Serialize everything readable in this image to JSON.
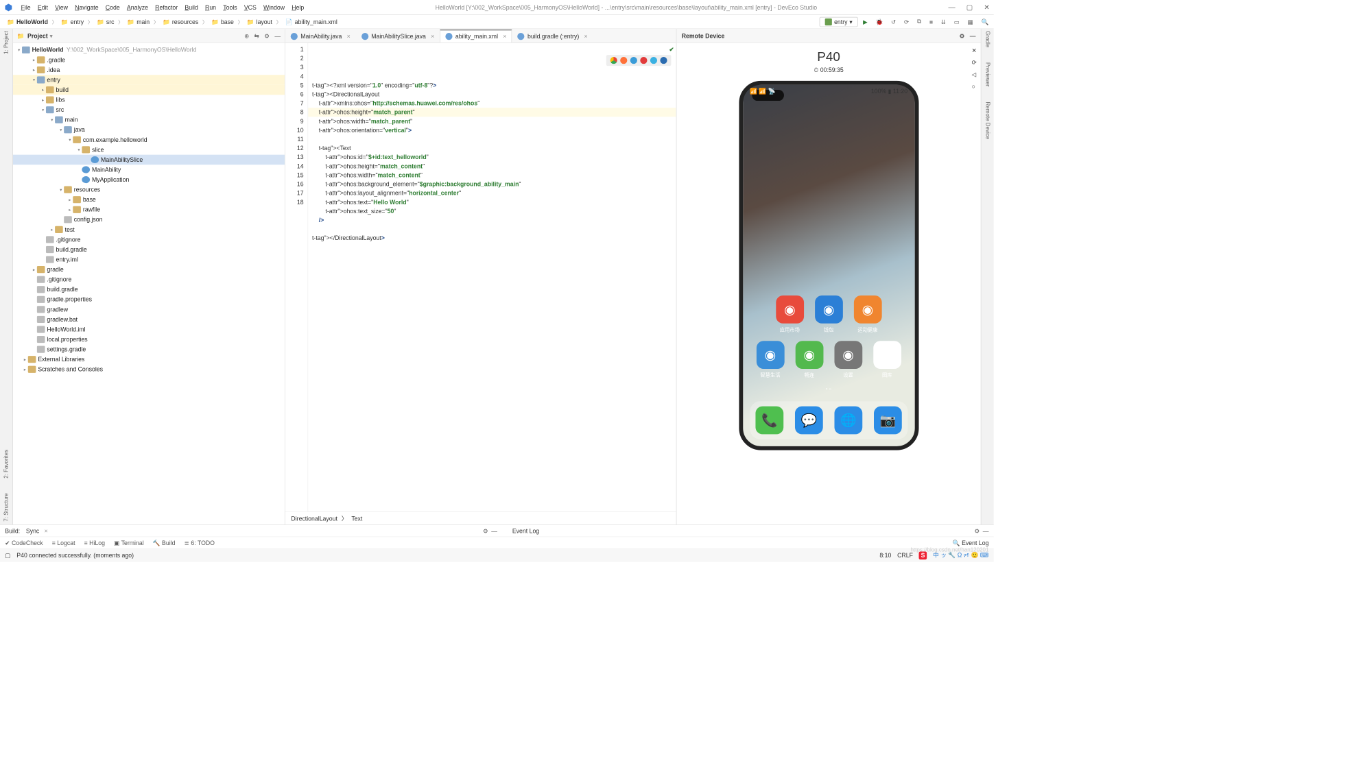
{
  "titlebar": {
    "title": "HelloWorld [Y:\\002_WorkSpace\\005_HarmonyOS\\HelloWorld] - ...\\entry\\src\\main\\resources\\base\\layout\\ability_main.xml [entry] - DevEco Studio"
  },
  "menubar": [
    "File",
    "Edit",
    "View",
    "Navigate",
    "Code",
    "Analyze",
    "Refactor",
    "Build",
    "Run",
    "Tools",
    "VCS",
    "Window",
    "Help"
  ],
  "breadcrumb": [
    "HelloWorld",
    "entry",
    "src",
    "main",
    "resources",
    "base",
    "layout",
    "ability_main.xml"
  ],
  "run_config": "entry",
  "project": {
    "title": "Project",
    "root": {
      "name": "HelloWorld",
      "path": "Y:\\002_WorkSpace\\005_HarmonyOS\\HelloWorld"
    },
    "items": [
      {
        "d": 1,
        "t": "folder",
        "n": ".gradle"
      },
      {
        "d": 1,
        "t": "folder",
        "n": ".idea"
      },
      {
        "d": 1,
        "t": "folder-blue",
        "n": "entry",
        "open": true,
        "hl": true
      },
      {
        "d": 2,
        "t": "folder",
        "n": "build",
        "hl": true
      },
      {
        "d": 2,
        "t": "folder",
        "n": "libs"
      },
      {
        "d": 2,
        "t": "folder-blue",
        "n": "src",
        "open": true
      },
      {
        "d": 3,
        "t": "folder-blue",
        "n": "main",
        "open": true
      },
      {
        "d": 4,
        "t": "folder-blue",
        "n": "java",
        "open": true
      },
      {
        "d": 5,
        "t": "folder",
        "n": "com.example.helloworld",
        "open": true
      },
      {
        "d": 6,
        "t": "folder",
        "n": "slice",
        "open": true
      },
      {
        "d": 7,
        "t": "java",
        "n": "MainAbilitySlice",
        "sel": true
      },
      {
        "d": 6,
        "t": "java",
        "n": "MainAbility"
      },
      {
        "d": 6,
        "t": "java",
        "n": "MyApplication"
      },
      {
        "d": 4,
        "t": "folder",
        "n": "resources",
        "open": true
      },
      {
        "d": 5,
        "t": "folder",
        "n": "base"
      },
      {
        "d": 5,
        "t": "folder",
        "n": "rawfile"
      },
      {
        "d": 4,
        "t": "file",
        "n": "config.json"
      },
      {
        "d": 3,
        "t": "folder",
        "n": "test"
      },
      {
        "d": 2,
        "t": "file",
        "n": ".gitignore"
      },
      {
        "d": 2,
        "t": "file",
        "n": "build.gradle"
      },
      {
        "d": 2,
        "t": "file",
        "n": "entry.iml"
      },
      {
        "d": 1,
        "t": "folder",
        "n": "gradle"
      },
      {
        "d": 1,
        "t": "file",
        "n": ".gitignore"
      },
      {
        "d": 1,
        "t": "file",
        "n": "build.gradle"
      },
      {
        "d": 1,
        "t": "file",
        "n": "gradle.properties"
      },
      {
        "d": 1,
        "t": "file",
        "n": "gradlew"
      },
      {
        "d": 1,
        "t": "file",
        "n": "gradlew.bat"
      },
      {
        "d": 1,
        "t": "file",
        "n": "HelloWorld.iml"
      },
      {
        "d": 1,
        "t": "file",
        "n": "local.properties"
      },
      {
        "d": 1,
        "t": "file",
        "n": "settings.gradle"
      },
      {
        "d": 0,
        "t": "folder",
        "n": "External Libraries"
      },
      {
        "d": 0,
        "t": "folder",
        "n": "Scratches and Consoles"
      }
    ]
  },
  "tabs": [
    {
      "label": "MainAbility.java"
    },
    {
      "label": "MainAbilitySlice.java"
    },
    {
      "label": "ability_main.xml",
      "active": true
    },
    {
      "label": "build.gradle (:entry)"
    }
  ],
  "code_lines": [
    "<?xml version=\"1.0\" encoding=\"utf-8\"?>",
    "<DirectionalLayout",
    "    xmlns:ohos=\"http://schemas.huawei.com/res/ohos\"",
    "    ohos:height=\"match_parent\"",
    "    ohos:width=\"match_parent\"",
    "    ohos:orientation=\"vertical\">",
    "",
    "    <Text",
    "        ohos:id=\"$+id:text_helloworld\"",
    "        ohos:height=\"match_content\"",
    "        ohos:width=\"match_content\"",
    "        ohos:background_element=\"$graphic:background_ability_main\"",
    "        ohos:layout_alignment=\"horizontal_center\"",
    "        ohos:text=\"Hello World\"",
    "        ohos:text_size=\"50\"",
    "    />",
    "",
    "</DirectionalLayout>"
  ],
  "code_crumb": [
    "DirectionalLayout",
    "Text"
  ],
  "right": {
    "title": "Remote Device",
    "device": "P40",
    "timer": "00:59:35",
    "phone_time": "11:20",
    "battery": "100%"
  },
  "phone_apps_row1": [
    {
      "label": "应用市场",
      "color": "#e84b3c"
    },
    {
      "label": "钱包",
      "color": "#2b7fd6"
    },
    {
      "label": "运动健康",
      "color": "#f0852f"
    }
  ],
  "phone_apps_row2": [
    {
      "label": "智慧生活",
      "color": "#3a8ed8"
    },
    {
      "label": "畅连",
      "color": "#53b94e"
    },
    {
      "label": "设置",
      "color": "#777"
    },
    {
      "label": "图库",
      "color": "#fff"
    }
  ],
  "dock_icons": [
    "#4fbf4f",
    "#2b8de6",
    "#2b8de6",
    "#2b8de6"
  ],
  "bottom": {
    "build_label": "Build:",
    "build_tab": "Sync",
    "eventlog": "Event Log",
    "tabs": [
      "CodeCheck",
      "Logcat",
      "HiLog",
      "Terminal",
      "Build",
      "TODO"
    ],
    "event_log_tab": "Event Log"
  },
  "status": {
    "msg": "P40 connected successfully. (moments ago)",
    "pos": "8:10",
    "enc": "CRLF"
  },
  "left_tabs": [
    "1: Project",
    "2: Favorites",
    "7: Structure"
  ],
  "right_tabs": [
    "Gradle",
    "Previewer",
    "Remote Device"
  ],
  "watermark": "https://blog.csdn.net/han120201"
}
